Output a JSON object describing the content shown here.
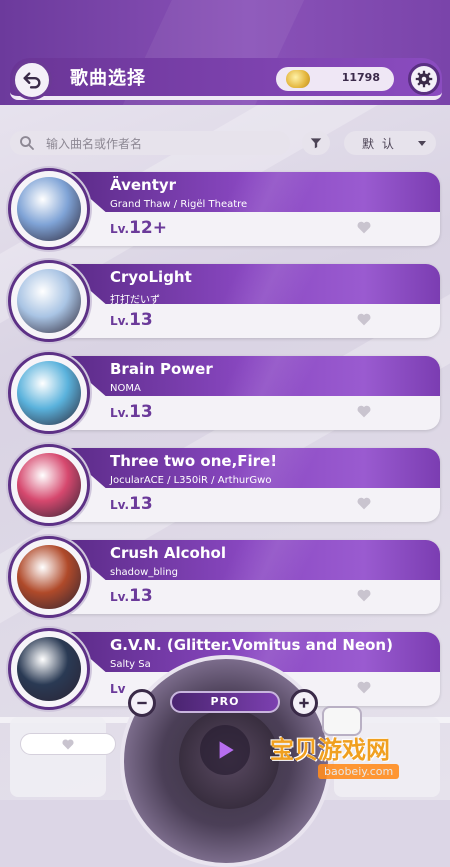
{
  "header": {
    "title": "歌曲选择",
    "coins": "11798"
  },
  "search": {
    "placeholder": "输入曲名或作者名",
    "sort_label": "默 认"
  },
  "songs": [
    {
      "title": "Äventyr",
      "artist": "Grand Thaw / Rigël Theatre",
      "level_prefix": "Lv.",
      "level": "12+",
      "cover": "#7fa3d6"
    },
    {
      "title": "CryoLight",
      "artist": "打打だいず",
      "level_prefix": "Lv.",
      "level": "13",
      "cover": "#a9c4e4"
    },
    {
      "title": "Brain Power",
      "artist": "NOMA",
      "level_prefix": "Lv.",
      "level": "13",
      "cover": "#5ab2dc"
    },
    {
      "title": "Three two one,Fire!",
      "artist": "JocularACE / L350iR / ArthurGwo",
      "level_prefix": "Lv.",
      "level": "13",
      "cover": "#d6486e"
    },
    {
      "title": "Crush Alcohol",
      "artist": "shadow_bling",
      "level_prefix": "Lv.",
      "level": "13",
      "cover": "#b04a2a"
    },
    {
      "title": "G.V.N. (Glitter.Vomitus and Neon)",
      "artist": "Salty Sa",
      "level_prefix": "Lv",
      "level": "",
      "cover": "#2a3a54"
    }
  ],
  "player": {
    "mode_label": "PRO"
  },
  "watermark": {
    "text": "宝贝游戏网",
    "url": "baobeiy.com"
  }
}
